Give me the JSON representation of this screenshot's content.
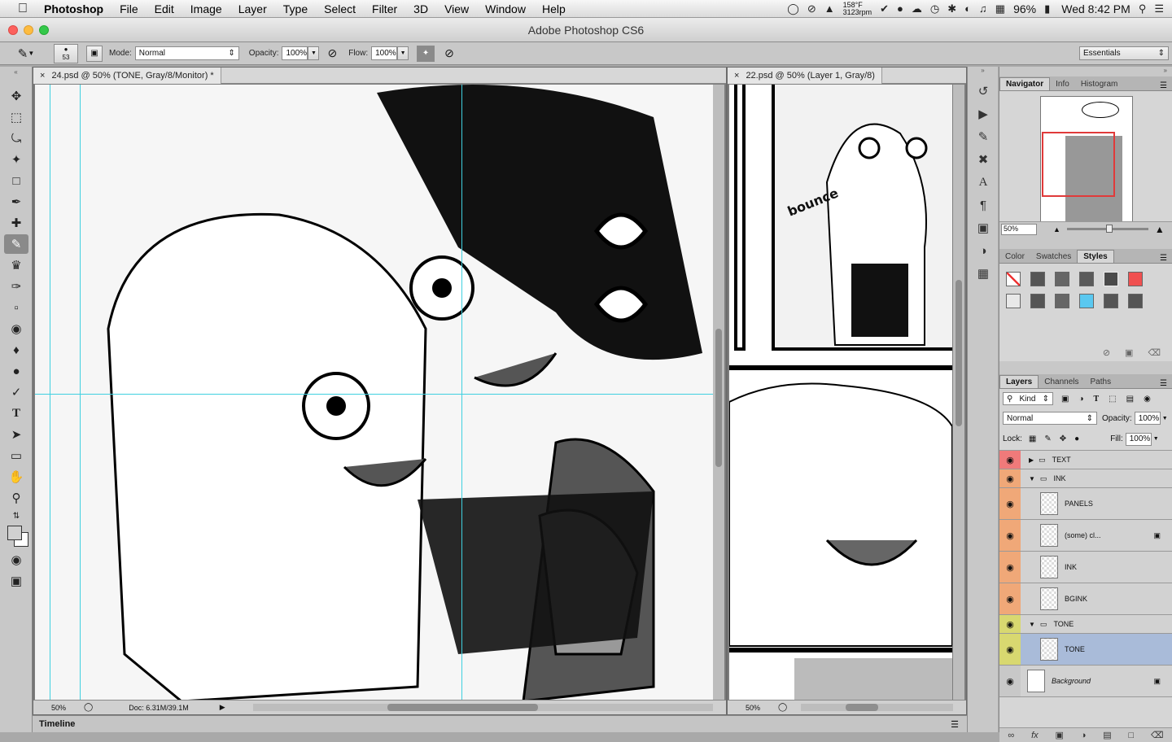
{
  "menubar": {
    "app": "Photoshop",
    "items": [
      "File",
      "Edit",
      "Image",
      "Layer",
      "Type",
      "Select",
      "Filter",
      "3D",
      "View",
      "Window",
      "Help"
    ],
    "status": {
      "temp": "158°F",
      "rpm": "3123rpm",
      "battery": "96%",
      "clock": "Wed 8:42 PM"
    }
  },
  "titlebar": {
    "title": "Adobe Photoshop CS6"
  },
  "options": {
    "brush_size": "53",
    "mode_label": "Mode:",
    "mode_value": "Normal",
    "opacity_label": "Opacity:",
    "opacity_value": "100%",
    "flow_label": "Flow:",
    "flow_value": "100%",
    "workspace": "Essentials"
  },
  "doc1": {
    "tab": "24.psd @ 50% (TONE, Gray/8/Monitor) *",
    "zoom": "50%",
    "doc_size": "Doc: 6.31M/39.1M"
  },
  "doc2": {
    "tab": "22.psd @ 50% (Layer 1, Gray/8)",
    "zoom": "50%",
    "sfx": "bounce"
  },
  "timeline": {
    "label": "Timeline"
  },
  "navigator": {
    "tabs": [
      "Navigator",
      "Info",
      "Histogram"
    ],
    "zoom": "50%"
  },
  "color_panel": {
    "tabs": [
      "Color",
      "Swatches",
      "Styles"
    ]
  },
  "layers_panel": {
    "tabs": [
      "Layers",
      "Channels",
      "Paths"
    ],
    "kind": "Kind",
    "blend": "Normal",
    "opacity_label": "Opacity:",
    "opacity": "100%",
    "lock_label": "Lock:",
    "fill_label": "Fill:",
    "fill": "100%",
    "layers": [
      {
        "name": "TEXT",
        "type": "group",
        "color": "#f07a7a"
      },
      {
        "name": "INK",
        "type": "group",
        "color": "#f0a878"
      },
      {
        "name": "PANELS",
        "type": "layer",
        "color": "#f0a878"
      },
      {
        "name": "(some) cl...",
        "type": "layer",
        "color": "#f0a878"
      },
      {
        "name": "INK",
        "type": "layer",
        "color": "#f0a878"
      },
      {
        "name": "BGINK",
        "type": "layer",
        "color": "#f0a878"
      },
      {
        "name": "TONE",
        "type": "group",
        "color": "#d8d870"
      },
      {
        "name": "TONE",
        "type": "layer",
        "color": "#d8d870",
        "selected": true
      },
      {
        "name": "Background",
        "type": "layer",
        "color": "#c8c8c8"
      }
    ]
  }
}
